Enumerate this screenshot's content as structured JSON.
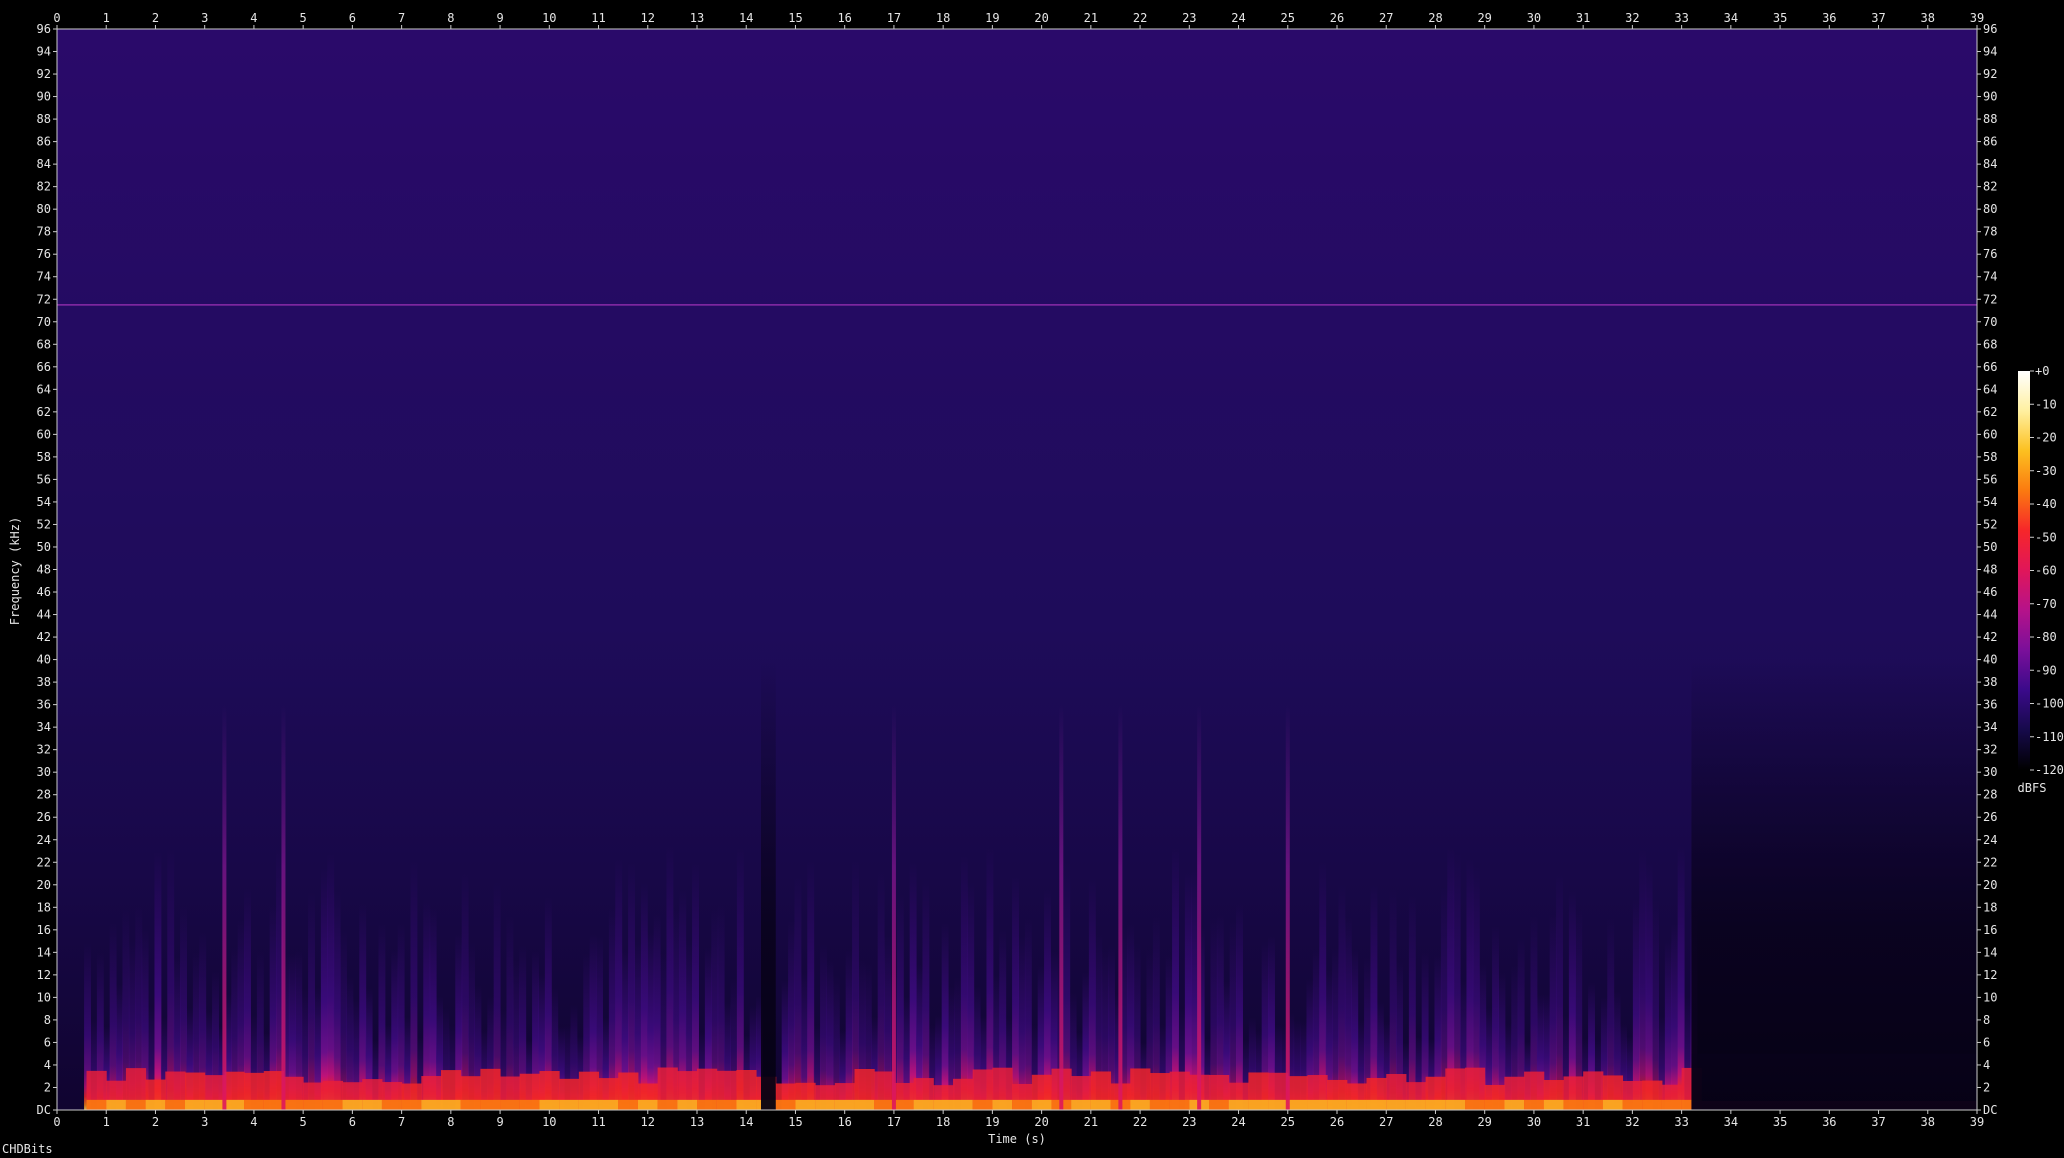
{
  "chart_data": {
    "type": "heatmap",
    "subtype": "spectrogram",
    "xlabel": "Time (s)",
    "ylabel": "Frequency (kHz)",
    "xlim": [
      0,
      39
    ],
    "ylim": [
      0,
      96
    ],
    "x_ticks": [
      "0",
      "1",
      "2",
      "3",
      "4",
      "5",
      "6",
      "7",
      "8",
      "9",
      "10",
      "11",
      "12",
      "13",
      "14",
      "15",
      "16",
      "17",
      "18",
      "19",
      "20",
      "21",
      "22",
      "23",
      "24",
      "25",
      "26",
      "27",
      "28",
      "29",
      "30",
      "31",
      "32",
      "33",
      "34",
      "35",
      "36",
      "37",
      "38",
      "39"
    ],
    "y_ticks": [
      "DC",
      "2",
      "4",
      "6",
      "8",
      "10",
      "12",
      "14",
      "16",
      "18",
      "20",
      "22",
      "24",
      "26",
      "28",
      "30",
      "32",
      "34",
      "36",
      "38",
      "40",
      "42",
      "44",
      "46",
      "48",
      "50",
      "52",
      "54",
      "56",
      "58",
      "60",
      "62",
      "64",
      "66",
      "68",
      "70",
      "72",
      "74",
      "76",
      "78",
      "80",
      "82",
      "84",
      "86",
      "88",
      "90",
      "92",
      "94",
      "96"
    ],
    "colorbar": {
      "label": "dBFS",
      "ticks": [
        "+0",
        "-10",
        "-20",
        "-30",
        "-40",
        "-50",
        "-60",
        "-70",
        "-80",
        "-90",
        "-100",
        "-110",
        "-120"
      ],
      "range": [
        -120,
        0
      ],
      "colors": [
        "#000000",
        "#160a4a",
        "#3a0a8a",
        "#7a0f9a",
        "#b5128a",
        "#e0165a",
        "#f6262a",
        "#fb7a10",
        "#fcc020",
        "#fff0a0",
        "#ffffff"
      ]
    },
    "reference_line_khz": 71.5,
    "reference_line_color": "#8a2aa8",
    "background_color": "#2a0a6a",
    "silent_segments_s": [
      [
        14.3,
        14.6
      ],
      [
        33.2,
        39
      ]
    ],
    "transient_peaks_s": [
      3.4,
      4.6,
      17.0,
      20.4,
      21.6,
      23.2,
      25.0
    ]
  },
  "footer": {
    "label": "CHDBits"
  }
}
